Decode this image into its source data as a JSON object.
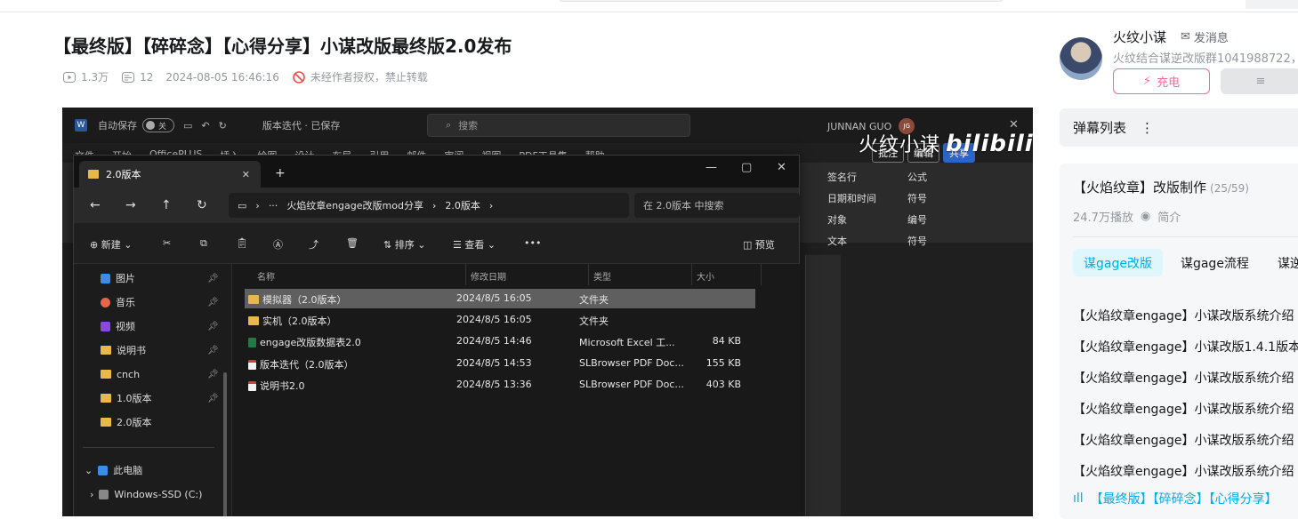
{
  "page": {
    "title": "【最终版】【碎碎念】【心得分享】小谋改版最终版2.0发布",
    "views": "1.3万",
    "danmaku_count": "12",
    "date": "2024-08-05 16:46:16",
    "copyright": "未经作者授权，禁止转载"
  },
  "word": {
    "logo": "W",
    "autosave": "自动保存",
    "autosave_state": "关",
    "doc_title": "版本迭代 · 已保存",
    "search": "搜索",
    "user": "JUNNAN GUO",
    "user_initials": "JG",
    "tabs": [
      "文件",
      "开始",
      "OfficePLUS",
      "插入",
      "绘图",
      "设计",
      "布局",
      "引用",
      "邮件",
      "审阅",
      "视图",
      "PDF工具集",
      "帮助"
    ],
    "ribbon": {
      "sign_line": "签名行",
      "datetime": "日期和时间",
      "object": "对象",
      "equation": "公式",
      "symbol": "符号",
      "number": "编号",
      "text_group": "文本",
      "symbol_group": "符号",
      "comment": "批注",
      "edit": "编辑",
      "share": "共享"
    }
  },
  "watermark": {
    "text": "火纹小谋",
    "brand": "bilibili"
  },
  "explorer": {
    "tab_title": "2.0版本",
    "path": [
      "火焰纹章engage改版mod分享",
      "2.0版本"
    ],
    "search_placeholder": "在 2.0版本 中搜索",
    "commands": {
      "new": "新建",
      "sort": "排序",
      "view": "查看",
      "preview": "预览"
    },
    "sidebar": [
      {
        "label": "图片",
        "icon": "pictures-icon",
        "color": "#3a8ee6",
        "pinned": true
      },
      {
        "label": "音乐",
        "icon": "music-icon",
        "color": "#e8654a",
        "pinned": true
      },
      {
        "label": "视频",
        "icon": "videos-icon",
        "color": "#8a4ad9",
        "pinned": true
      },
      {
        "label": "说明书",
        "icon": "folder-icon",
        "color": "#e8b84a",
        "pinned": true
      },
      {
        "label": "cnch",
        "icon": "folder-icon",
        "color": "#e8b84a",
        "pinned": true
      },
      {
        "label": "1.0版本",
        "icon": "folder-icon",
        "color": "#e8b84a",
        "pinned": true
      },
      {
        "label": "2.0版本",
        "icon": "folder-icon",
        "color": "#e8b84a",
        "pinned": false
      }
    ],
    "this_pc": "此电脑",
    "drive": "Windows-SSD (C:)",
    "columns": [
      "名称",
      "修改日期",
      "类型",
      "大小"
    ],
    "files": [
      {
        "name": "模拟器（2.0版本）",
        "date": "2024/8/5 16:05",
        "type": "文件夹",
        "size": "",
        "kind": "folder"
      },
      {
        "name": "实机（2.0版本）",
        "date": "2024/8/5 16:05",
        "type": "文件夹",
        "size": "",
        "kind": "folder"
      },
      {
        "name": "engage改版数据表2.0",
        "date": "2024/8/5 14:46",
        "type": "Microsoft Excel 工...",
        "size": "84 KB",
        "kind": "excel"
      },
      {
        "name": "版本迭代（2.0版本）",
        "date": "2024/8/5 14:53",
        "type": "SLBrowser PDF Doc...",
        "size": "155 KB",
        "kind": "pdf"
      },
      {
        "name": "说明书2.0",
        "date": "2024/8/5 13:36",
        "type": "SLBrowser PDF Doc...",
        "size": "403 KB",
        "kind": "pdf"
      }
    ]
  },
  "uploader": {
    "name": "火纹小谋",
    "message": "发消息",
    "desc": "火纹结合谋逆改版群1041988722，",
    "charge": "充电"
  },
  "sidebar": {
    "danmaku_list": "弹幕列表",
    "playlist_title": "【火焰纹章】改版制作",
    "playlist_progress": "(25/59)",
    "playlist_plays": "24.7万播放",
    "playlist_intro": "简介",
    "tabs": [
      "谋gage改版",
      "谋gage流程",
      "谋逆g"
    ],
    "items": [
      "【火焰纹章engage】小谋改版系统介绍",
      "【火焰纹章engage】小谋改版1.4.1版本",
      "【火焰纹章engage】小谋改版系统介绍",
      "【火焰纹章engage】小谋改版系统介绍",
      "【火焰纹章engage】小谋改版系统介绍",
      "【火焰纹章engage】小谋改版系统介绍"
    ],
    "now_playing": "【最终版】【碎碎念】【心得分享】"
  }
}
